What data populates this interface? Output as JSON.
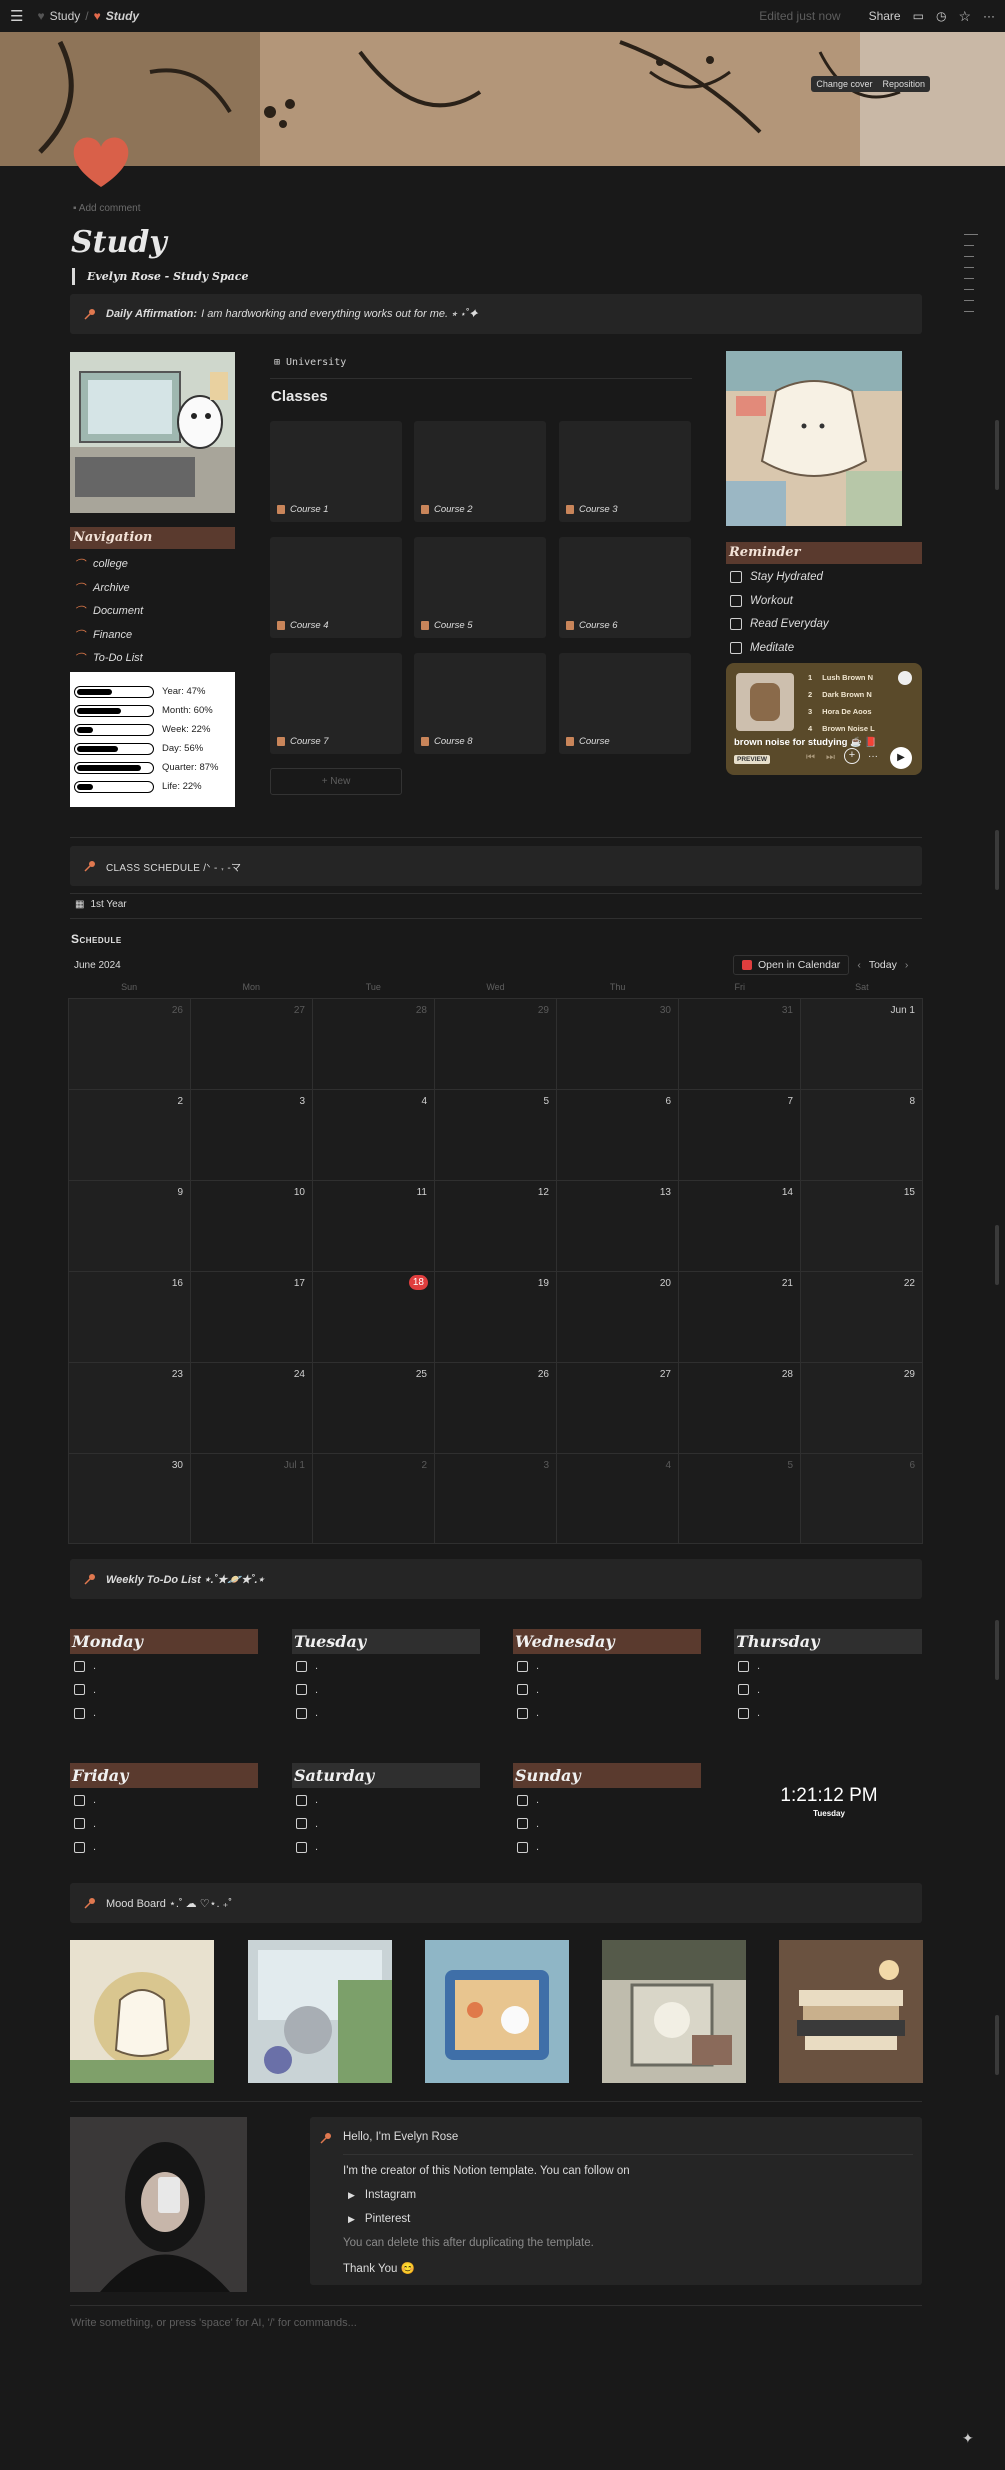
{
  "topbar": {
    "crumb1": "Study",
    "sep": "/",
    "crumb2": "Study",
    "edited": "Edited just now",
    "share": "Share"
  },
  "cover": {
    "change": "Change cover",
    "reposition": "Reposition"
  },
  "add_comment": "Add comment",
  "title": "Study",
  "subtitle": "Evelyn Rose - Study Space",
  "affirmation": {
    "label": "Daily Affirmation:",
    "text": "I am hardworking and everything works out for me. ⭒ ⋆˚✦"
  },
  "navigation": {
    "heading": "Navigation",
    "items": [
      "college",
      "Archive",
      "Document",
      "Finance",
      "To-Do List"
    ]
  },
  "progress": [
    {
      "label": "Year: 47%",
      "value": 0.47
    },
    {
      "label": "Month: 60%",
      "value": 0.6
    },
    {
      "label": "Week: 22%",
      "value": 0.22
    },
    {
      "label": "Day: 56%",
      "value": 0.56
    },
    {
      "label": "Quarter: 87%",
      "value": 0.87
    },
    {
      "label": "Life: 22%",
      "value": 0.22
    }
  ],
  "university": {
    "view": "University",
    "heading": "Classes",
    "courses": [
      "Course 1",
      "Course 2",
      "Course 3",
      "Course 4",
      "Course 5",
      "Course 6",
      "Course 7",
      "Course 8",
      "Course"
    ],
    "new": "+ New"
  },
  "reminder": {
    "heading": "Reminder",
    "items": [
      "Stay Hydrated",
      "Workout",
      "Read Everyday",
      "Meditate"
    ]
  },
  "spotify": {
    "tracks": [
      {
        "n": "1",
        "t": "Lush Brown N"
      },
      {
        "n": "2",
        "t": "Dark Brown N"
      },
      {
        "n": "3",
        "t": "Hora De Aoos"
      },
      {
        "n": "4",
        "t": "Brown Noise L"
      }
    ],
    "title": "brown noise for studying ☕ 📕",
    "preview": "PREVIEW",
    "more": "···"
  },
  "class_schedule": "CLASS SCHEDULE /ᐠ - ˕ -マ",
  "year_tab": "1st Year",
  "schedule": {
    "heading": "Schedule",
    "month": "June 2024",
    "open": "Open in Calendar",
    "today": "Today",
    "weekdays": [
      "Sun",
      "Mon",
      "Tue",
      "Wed",
      "Thu",
      "Fri",
      "Sat"
    ],
    "weeks": [
      [
        "26",
        "27",
        "28",
        "29",
        "30",
        "31",
        "Jun 1"
      ],
      [
        "2",
        "3",
        "4",
        "5",
        "6",
        "7",
        "8"
      ],
      [
        "9",
        "10",
        "11",
        "12",
        "13",
        "14",
        "15"
      ],
      [
        "16",
        "17",
        "18",
        "19",
        "20",
        "21",
        "22"
      ],
      [
        "23",
        "24",
        "25",
        "26",
        "27",
        "28",
        "29"
      ],
      [
        "30",
        "Jul 1",
        "2",
        "3",
        "4",
        "5",
        "6"
      ]
    ],
    "today_date": "18"
  },
  "weekly_todo": "Weekly To-Do List ⋆.˚★🪐★˚.⋆",
  "days": [
    "Monday",
    "Tuesday",
    "Wednesday",
    "Thursday",
    "Friday",
    "Saturday",
    "Sunday"
  ],
  "todo_placeholder": ".",
  "clock": {
    "time": "1:21:12 PM",
    "day": "Tuesday"
  },
  "mood_board": "Mood Board ⋆.˚ ☁︎ ♡⋆. ₊˚",
  "hello": {
    "title": "Hello, I'm Evelyn Rose",
    "line1": "I'm the creator of this Notion template. You can follow on",
    "t1": "Instagram",
    "t2": "Pinterest",
    "line2": "You can delete this after duplicating the template.",
    "line3": "Thank You 😊"
  },
  "write_placeholder": "Write something, or press 'space' for AI, '/' for commands...",
  "colors": {
    "accent_brown": "#5a3a2e",
    "today_red": "#e03e3e",
    "page_bg": "#191919"
  }
}
